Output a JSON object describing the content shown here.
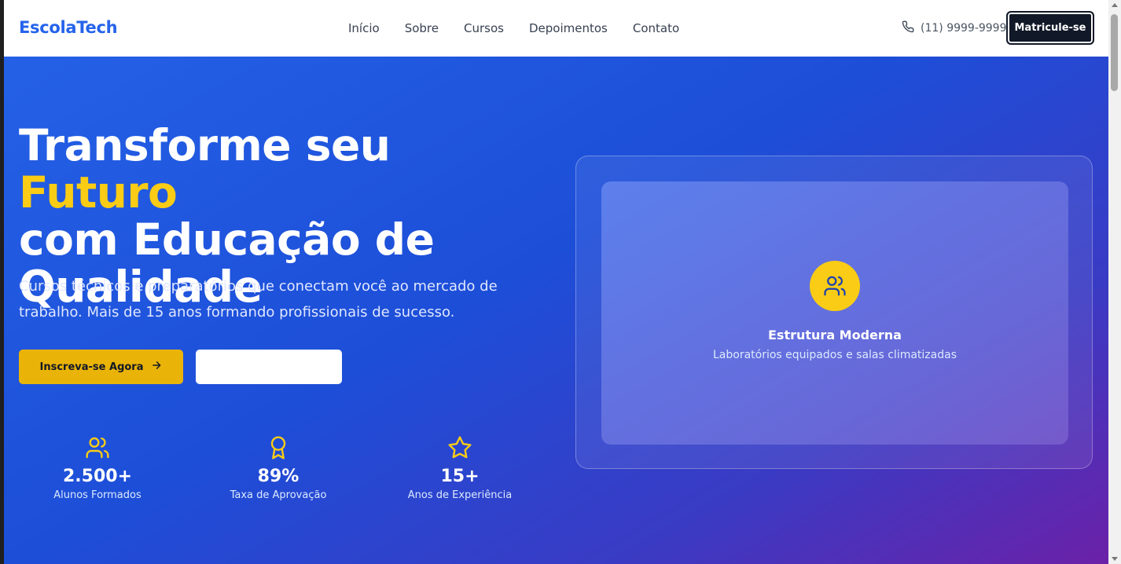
{
  "header": {
    "logo": "EscolaTech",
    "nav": [
      "Início",
      "Sobre",
      "Cursos",
      "Depoimentos",
      "Contato"
    ],
    "phone": "(11) 9999-9999",
    "cta": "Matricule-se"
  },
  "hero": {
    "title_part1": "Transforme seu ",
    "title_accent": "Futuro",
    "title_part2": "com Educação de Qualidade",
    "subtitle": "Cursos técnicos e preparatórios que conectam você ao mercado de trabalho. Mais de 15 anos formando profissionais de sucesso.",
    "primary_button": "Inscreva-se Agora",
    "secondary_button": ""
  },
  "stats": [
    {
      "icon": "users-icon",
      "value": "2.500+",
      "label": "Alunos Formados"
    },
    {
      "icon": "award-icon",
      "value": "89%",
      "label": "Taxa de Aprovação"
    },
    {
      "icon": "star-icon",
      "value": "15+",
      "label": "Anos de Experiência"
    }
  ],
  "feature": {
    "icon": "users-icon",
    "title": "Estrutura Moderna",
    "description": "Laboratórios equipados e salas climatizadas"
  },
  "colors": {
    "brand": "#2563eb",
    "accent": "#facc15",
    "button_primary": "#eab308",
    "dark_button": "#111827"
  }
}
